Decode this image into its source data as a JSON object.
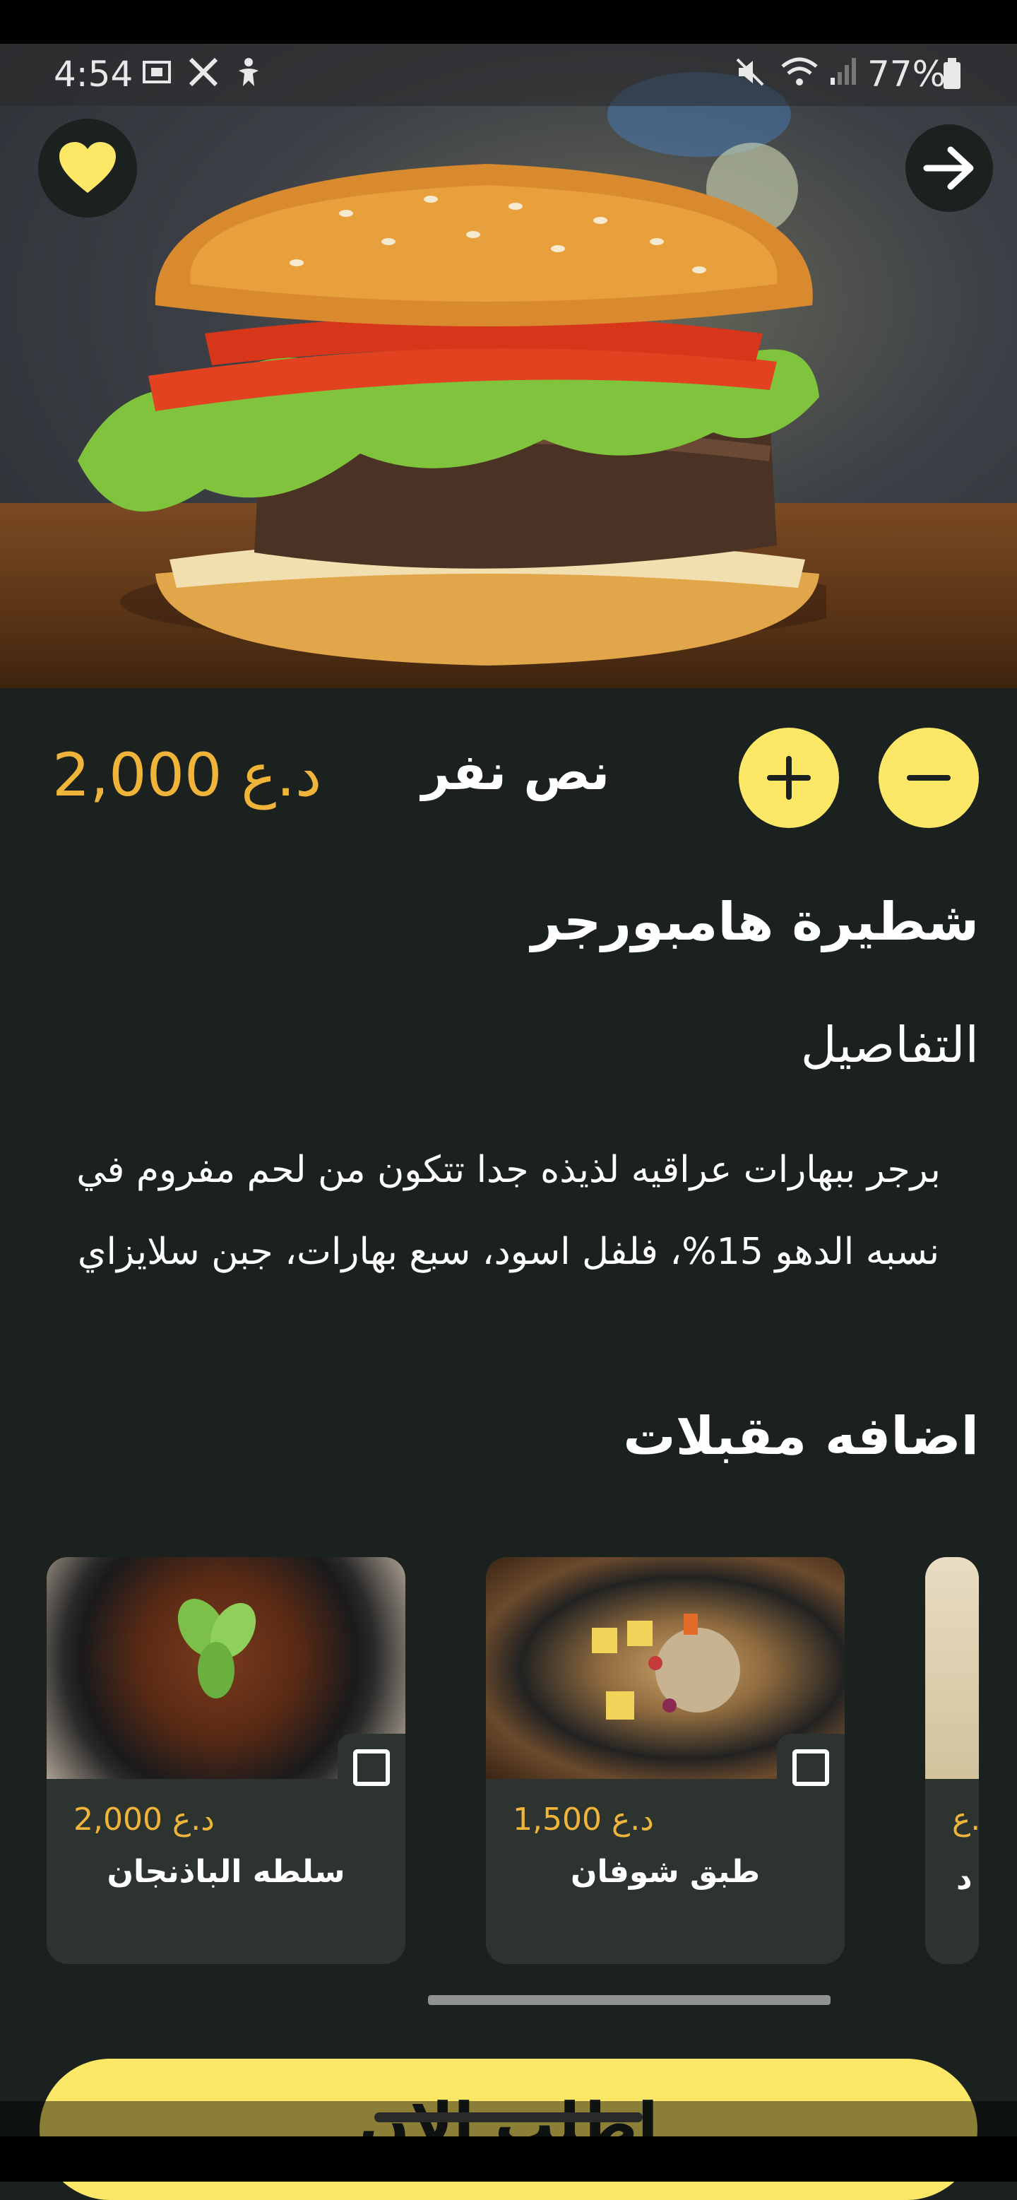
{
  "status_bar": {
    "time": "4:54",
    "battery": "77%",
    "icons": [
      "screenshot-icon",
      "x-app-icon",
      "accessibility-icon",
      "mute-icon",
      "wifi-icon",
      "signal-icon",
      "battery-icon"
    ]
  },
  "product": {
    "price": "2,000 د.ع",
    "portion": "نص نفر",
    "name": "شطيرة هامبورجر",
    "details_heading": "التفاصيل",
    "description": "برجر ببهارات عراقيه لذيذه جدا تتكون من لحم مفروم في نسبه الدهو 15%، فلفل اسود، سبع بهارات، جبن سلايزاي"
  },
  "addons": {
    "heading": "اضافه مقبلات",
    "items": [
      {
        "name": "سلطه الباذنجان",
        "price": "2,000 د.ع"
      },
      {
        "name": "طبق شوفان",
        "price": "1,500 د.ع"
      },
      {
        "name": "د",
        "price": "د.ع"
      }
    ]
  },
  "order_button": {
    "label": "اطلب الان"
  },
  "colors": {
    "background": "#1b211e",
    "accent": "#fde767",
    "price": "#f0b43a",
    "card": "#2d332f"
  }
}
